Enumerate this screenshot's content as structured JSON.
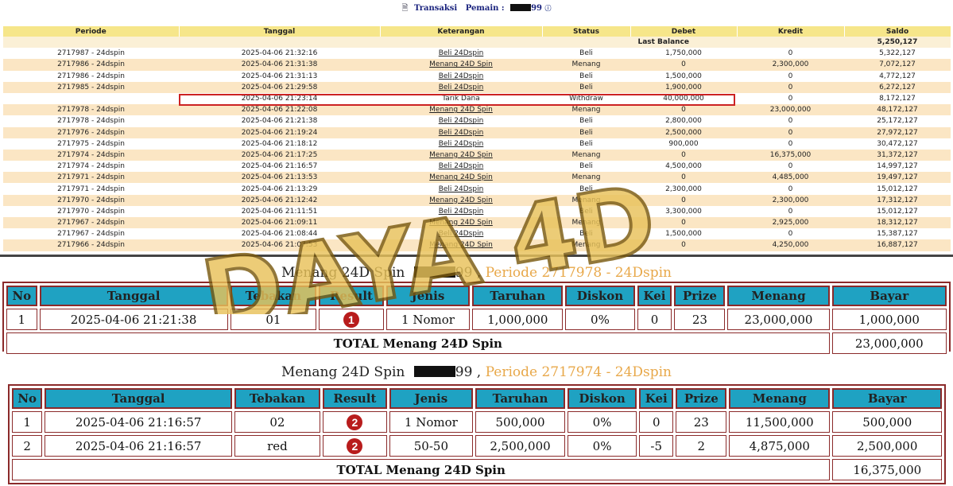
{
  "header": {
    "doc_icon": "document-icon",
    "title_prefix": "Transaksi",
    "pemain_label": "Pemain :",
    "player_suffix": "99",
    "info_icon": "i"
  },
  "transactions": {
    "columns": [
      "Periode",
      "Tanggal",
      "Keterangan",
      "Status",
      "Debet",
      "Kredit",
      "Saldo"
    ],
    "last_balance_label": "Last Balance",
    "last_balance_value": "5,250,127",
    "rows": [
      {
        "periode": "2717987 - 24dspin",
        "tanggal": "2025-04-06 21:32:16",
        "keterangan": "Beli 24Dspin",
        "status": "Beli",
        "debet": "1,750,000",
        "kredit": "0",
        "saldo": "5,322,127"
      },
      {
        "periode": "2717986 - 24dspin",
        "tanggal": "2025-04-06 21:31:38",
        "keterangan": "Menang 24D Spin",
        "status": "Menang",
        "debet": "0",
        "kredit": "2,300,000",
        "saldo": "7,072,127"
      },
      {
        "periode": "2717986 - 24dspin",
        "tanggal": "2025-04-06 21:31:13",
        "keterangan": "Beli 24Dspin",
        "status": "Beli",
        "debet": "1,500,000",
        "kredit": "0",
        "saldo": "4,772,127"
      },
      {
        "periode": "2717985 - 24dspin",
        "tanggal": "2025-04-06 21:29:58",
        "keterangan": "Beli 24Dspin",
        "status": "Beli",
        "debet": "1,900,000",
        "kredit": "0",
        "saldo": "6,272,127"
      },
      {
        "periode": "",
        "tanggal": "2025-04-06 21:23:14",
        "keterangan": "Tarik Dana",
        "status": "Withdraw",
        "debet": "40,000,000",
        "kredit": "0",
        "saldo": "8,172,127"
      },
      {
        "periode": "2717978 - 24dspin",
        "tanggal": "2025-04-06 21:22:08",
        "keterangan": "Menang 24D Spin",
        "status": "Menang",
        "debet": "0",
        "kredit": "23,000,000",
        "saldo": "48,172,127"
      },
      {
        "periode": "2717978 - 24dspin",
        "tanggal": "2025-04-06 21:21:38",
        "keterangan": "Beli 24Dspin",
        "status": "Beli",
        "debet": "2,800,000",
        "kredit": "0",
        "saldo": "25,172,127"
      },
      {
        "periode": "2717976 - 24dspin",
        "tanggal": "2025-04-06 21:19:24",
        "keterangan": "Beli 24Dspin",
        "status": "Beli",
        "debet": "2,500,000",
        "kredit": "0",
        "saldo": "27,972,127"
      },
      {
        "periode": "2717975 - 24dspin",
        "tanggal": "2025-04-06 21:18:12",
        "keterangan": "Beli 24Dspin",
        "status": "Beli",
        "debet": "900,000",
        "kredit": "0",
        "saldo": "30,472,127"
      },
      {
        "periode": "2717974 - 24dspin",
        "tanggal": "2025-04-06 21:17:25",
        "keterangan": "Menang 24D Spin",
        "status": "Menang",
        "debet": "0",
        "kredit": "16,375,000",
        "saldo": "31,372,127"
      },
      {
        "periode": "2717974 - 24dspin",
        "tanggal": "2025-04-06 21:16:57",
        "keterangan": "Beli 24Dspin",
        "status": "Beli",
        "debet": "4,500,000",
        "kredit": "0",
        "saldo": "14,997,127"
      },
      {
        "periode": "2717971 - 24dspin",
        "tanggal": "2025-04-06 21:13:53",
        "keterangan": "Menang 24D Spin",
        "status": "Menang",
        "debet": "0",
        "kredit": "4,485,000",
        "saldo": "19,497,127"
      },
      {
        "periode": "2717971 - 24dspin",
        "tanggal": "2025-04-06 21:13:29",
        "keterangan": "Beli 24Dspin",
        "status": "Beli",
        "debet": "2,300,000",
        "kredit": "0",
        "saldo": "15,012,127"
      },
      {
        "periode": "2717970 - 24dspin",
        "tanggal": "2025-04-06 21:12:42",
        "keterangan": "Menang 24D Spin",
        "status": "Menang",
        "debet": "0",
        "kredit": "2,300,000",
        "saldo": "17,312,127"
      },
      {
        "periode": "2717970 - 24dspin",
        "tanggal": "2025-04-06 21:11:51",
        "keterangan": "Beli 24Dspin",
        "status": "Beli",
        "debet": "3,300,000",
        "kredit": "0",
        "saldo": "15,012,127"
      },
      {
        "periode": "2717967 - 24dspin",
        "tanggal": "2025-04-06 21:09:11",
        "keterangan": "Menang 24D Spin",
        "status": "Menang",
        "debet": "0",
        "kredit": "2,925,000",
        "saldo": "18,312,127"
      },
      {
        "periode": "2717967 - 24dspin",
        "tanggal": "2025-04-06 21:08:44",
        "keterangan": "Beli 24Dspin",
        "status": "Beli",
        "debet": "1,500,000",
        "kredit": "0",
        "saldo": "15,387,127"
      },
      {
        "periode": "2717966 - 24dspin",
        "tanggal": "2025-04-06 21:07:53",
        "keterangan": "Menang 24D Spin",
        "status": "Menang",
        "debet": "0",
        "kredit": "4,250,000",
        "saldo": "16,887,127"
      }
    ]
  },
  "detail_columns": [
    "No",
    "Tanggal",
    "Tebakan",
    "Result",
    "Jenis",
    "Taruhan",
    "Diskon",
    "Kei",
    "Prize",
    "Menang",
    "Bayar"
  ],
  "detail_sections": [
    {
      "title_prefix": "Menang 24D Spin",
      "player_suffix": "99",
      "separator": ",",
      "periode": "Periode 2717978 - 24Dspin",
      "rows": [
        {
          "no": "1",
          "tanggal": "2025-04-06 21:21:38",
          "tebakan": "01",
          "result": "1",
          "jenis": "1 Nomor",
          "taruhan": "1,000,000",
          "diskon": "0%",
          "kei": "0",
          "prize": "23",
          "menang": "23,000,000",
          "bayar": "1,000,000"
        }
      ],
      "total_label": "TOTAL  Menang 24D Spin",
      "total_value": "23,000,000"
    },
    {
      "title_prefix": "Menang 24D Spin",
      "player_suffix": "99",
      "separator": ",",
      "periode": "Periode 2717974 - 24Dspin",
      "rows": [
        {
          "no": "1",
          "tanggal": "2025-04-06 21:16:57",
          "tebakan": "02",
          "result": "2",
          "jenis": "1 Nomor",
          "taruhan": "500,000",
          "diskon": "0%",
          "kei": "0",
          "prize": "23",
          "menang": "11,500,000",
          "bayar": "500,000"
        },
        {
          "no": "2",
          "tanggal": "2025-04-06 21:16:57",
          "tebakan": "red",
          "result": "2",
          "jenis": "50-50",
          "taruhan": "2,500,000",
          "diskon": "0%",
          "kei": "-5",
          "prize": "2",
          "menang": "4,875,000",
          "bayar": "2,500,000"
        }
      ],
      "total_label": "TOTAL  Menang 24D Spin",
      "total_value": "16,375,000"
    }
  ],
  "watermark": {
    "text": "DAYA 4D",
    "colors": {
      "gold": "#e8c25a",
      "red": "#d93a2a"
    }
  },
  "colors": {
    "header_bg": "#f6e68a",
    "row_alt": "#fbe6c4",
    "detail_header": "#1fa2c2",
    "border": "#8b2a2a",
    "ball": "#b81c1c"
  }
}
